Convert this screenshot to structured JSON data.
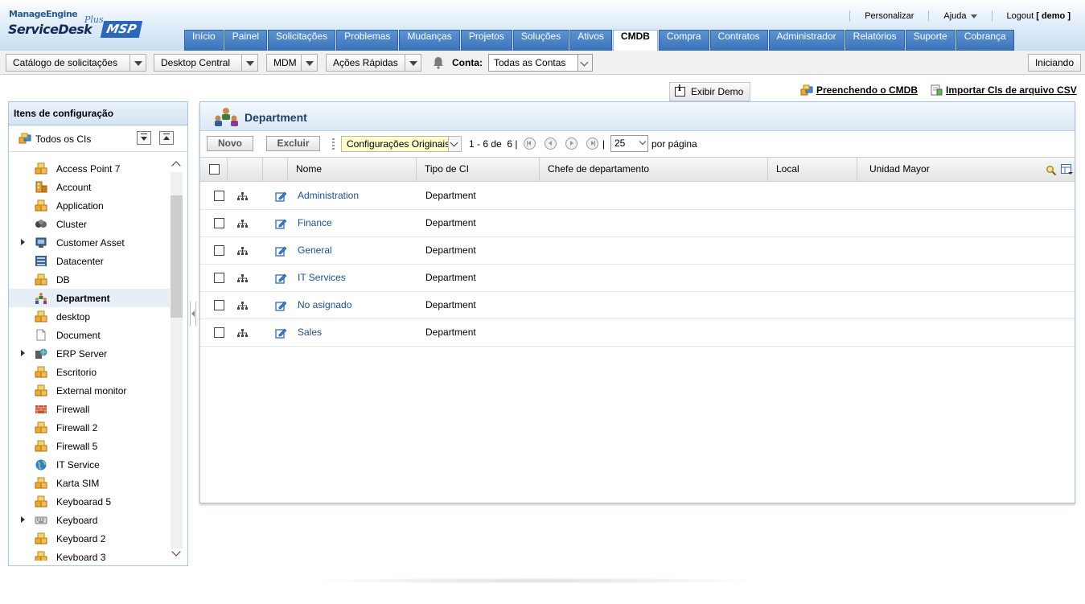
{
  "header": {
    "logo": {
      "brand": "ManageEngine",
      "product": "ServiceDesk",
      "plus": "Plus",
      "edition": "MSP"
    },
    "links": {
      "personalizar": "Personalizar",
      "ajuda": "Ajuda",
      "logout_prefix": "Logout",
      "user": "[ demo ]"
    },
    "tabs": [
      "Início",
      "Painel",
      "Solicitações",
      "Problemas",
      "Mudanças",
      "Projetos",
      "Soluções",
      "Ativos",
      "CMDB",
      "Compra",
      "Contratos",
      "Administrador",
      "Relatórios",
      "Suporte",
      "Cobrança"
    ],
    "active_tab": "CMDB"
  },
  "toolbar": {
    "catalog": "Catálogo de solicitações",
    "desktop": "Desktop Central",
    "mdm": "MDM",
    "acoes": "Ações Rápidas",
    "conta_label": "Conta:",
    "conta_value": "Todas as Contas",
    "iniciando": "Iniciando"
  },
  "actions": {
    "demo": "Exibir Demo",
    "preenchendo": "Preenchendo o CMDB",
    "importar": "Importar CIs de arquivo CSV"
  },
  "left_panel": {
    "title": "Itens de configuração",
    "all": "Todos os CIs",
    "items": [
      {
        "label": "Access Point 7",
        "expandable": false,
        "icon": "box-icon"
      },
      {
        "label": "Account",
        "expandable": false,
        "icon": "account-icon"
      },
      {
        "label": "Application",
        "expandable": false,
        "icon": "box-icon"
      },
      {
        "label": "Cluster",
        "expandable": false,
        "icon": "cluster-icon"
      },
      {
        "label": "Customer Asset",
        "expandable": true,
        "icon": "asset-icon"
      },
      {
        "label": "Datacenter",
        "expandable": false,
        "icon": "datacenter-icon"
      },
      {
        "label": "DB",
        "expandable": false,
        "icon": "box-icon"
      },
      {
        "label": "Department",
        "expandable": false,
        "icon": "department-icon",
        "selected": true
      },
      {
        "label": "desktop",
        "expandable": false,
        "icon": "box-icon"
      },
      {
        "label": "Document",
        "expandable": false,
        "icon": "document-icon"
      },
      {
        "label": "ERP Server",
        "expandable": true,
        "icon": "server-icon"
      },
      {
        "label": "Escritorio",
        "expandable": false,
        "icon": "box-icon"
      },
      {
        "label": "External monitor",
        "expandable": false,
        "icon": "box-icon"
      },
      {
        "label": "Firewall",
        "expandable": false,
        "icon": "firewall-icon"
      },
      {
        "label": "Firewall 2",
        "expandable": false,
        "icon": "box-icon"
      },
      {
        "label": "Firewall 5",
        "expandable": false,
        "icon": "box-icon"
      },
      {
        "label": "IT Service",
        "expandable": false,
        "icon": "globe-icon"
      },
      {
        "label": "Karta SIM",
        "expandable": false,
        "icon": "box-icon"
      },
      {
        "label": "Keyboarad 5",
        "expandable": false,
        "icon": "box-icon"
      },
      {
        "label": "Keyboard",
        "expandable": true,
        "icon": "keyboard-icon"
      },
      {
        "label": "Keyboard 2",
        "expandable": false,
        "icon": "box-icon"
      },
      {
        "label": "Keyboard 3",
        "expandable": false,
        "icon": "box-icon"
      }
    ]
  },
  "main": {
    "title": "Department",
    "novo": "Novo",
    "excluir": "Excluir",
    "view": "Configurações Originais",
    "range": "1 - 6 de",
    "total": "6",
    "page_size": "25",
    "por_pagina": "por página",
    "columns": [
      "Nome",
      "Tipo de CI",
      "Chefe de departamento",
      "Local",
      "Unidad Mayor"
    ],
    "rows": [
      {
        "name": "Administration",
        "type": "Department"
      },
      {
        "name": "Finance",
        "type": "Department"
      },
      {
        "name": "General",
        "type": "Department"
      },
      {
        "name": "IT Services",
        "type": "Department"
      },
      {
        "name": "No asignado",
        "type": "Department"
      },
      {
        "name": "Sales",
        "type": "Department"
      }
    ]
  },
  "colors": {
    "tab_blue": "#3a73bb",
    "link_blue": "#1c4e8c",
    "panel_border": "#a8c3dd"
  }
}
